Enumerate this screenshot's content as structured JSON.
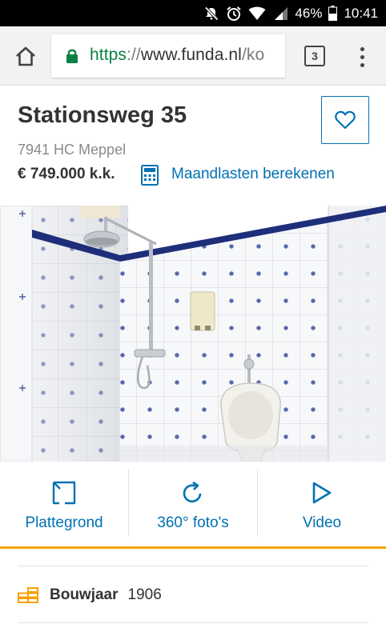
{
  "status_bar": {
    "battery": "46%",
    "time": "10:41",
    "icons": [
      "mute-icon",
      "alarm-icon",
      "wifi-icon",
      "signal-icon",
      "battery-icon"
    ]
  },
  "browser": {
    "url_scheme": "https",
    "url_sep": "://",
    "url_host": "www.funda.nl",
    "url_rest": "/ko",
    "tab_count": "3"
  },
  "listing": {
    "title": "Stationsweg 35",
    "postcode": "7941 HC Meppel",
    "price": "€ 749.000 k.k.",
    "mortgage_link": "Maandlasten berekenen"
  },
  "actions": {
    "floorplan": "Plattegrond",
    "photos360": "360° foto's",
    "video": "Video"
  },
  "features": [
    {
      "label": "Bouwjaar",
      "value": "1906"
    }
  ],
  "colors": {
    "accent_blue": "#0071b3",
    "accent_orange": "#f7a100",
    "secure_green": "#0b8043"
  }
}
